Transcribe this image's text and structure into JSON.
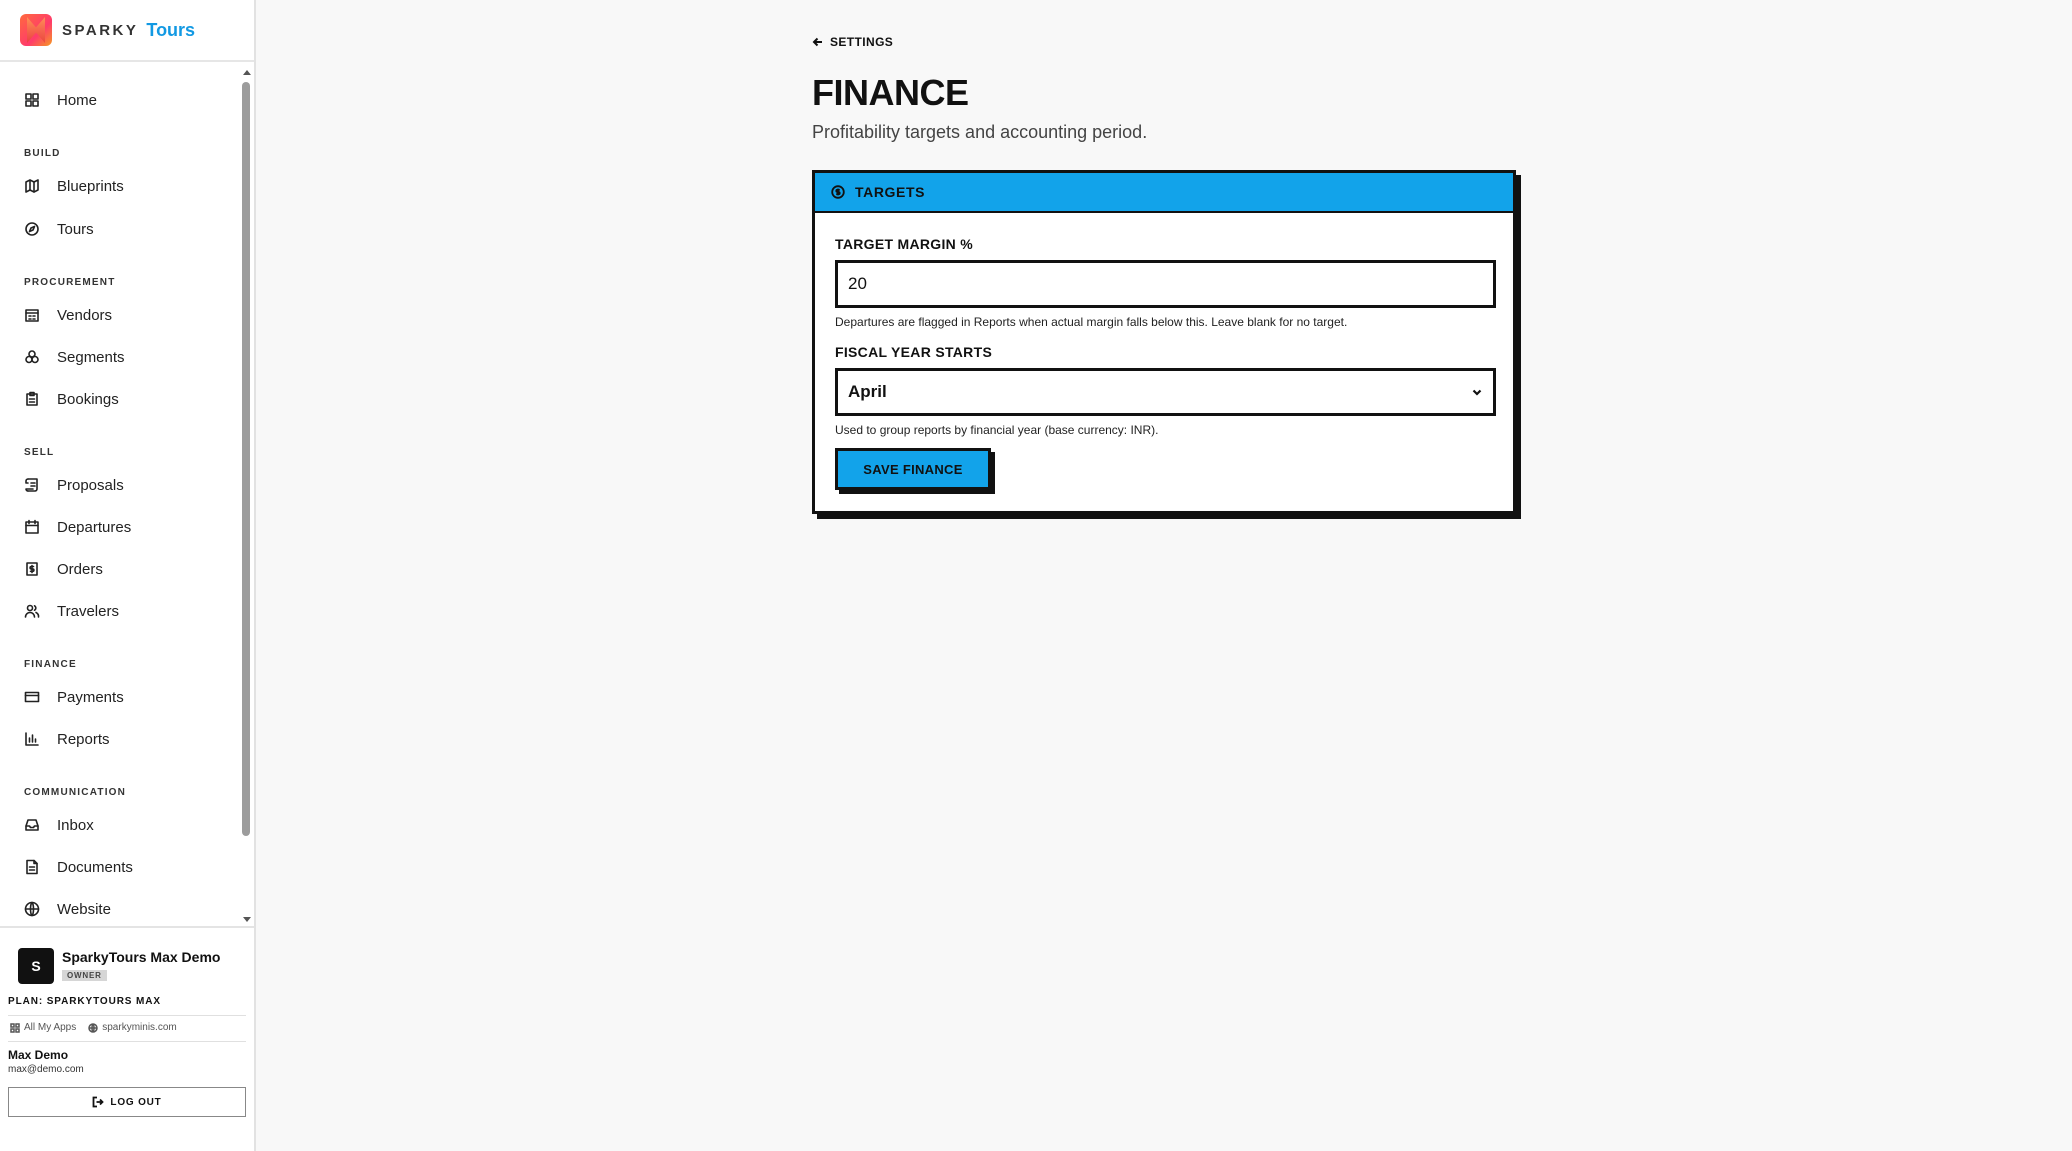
{
  "brand": {
    "word": "SPARKY",
    "product": "Tours"
  },
  "nav": {
    "home": "Home",
    "sections": {
      "build": "BUILD",
      "procurement": "PROCUREMENT",
      "sell": "SELL",
      "finance": "FINANCE",
      "communication": "COMMUNICATION"
    },
    "items": {
      "blueprints": "Blueprints",
      "tours": "Tours",
      "vendors": "Vendors",
      "segments": "Segments",
      "bookings": "Bookings",
      "proposals": "Proposals",
      "departures": "Departures",
      "orders": "Orders",
      "travelers": "Travelers",
      "payments": "Payments",
      "reports": "Reports",
      "inbox": "Inbox",
      "documents": "Documents",
      "website": "Website"
    }
  },
  "org": {
    "avatar_letter": "S",
    "name": "SparkyTours Max Demo",
    "role": "OWNER",
    "plan": "PLAN: SPARKYTOURS MAX",
    "all_apps": "All My Apps",
    "site": "sparkyminis.com"
  },
  "user": {
    "name": "Max Demo",
    "email": "max@demo.com",
    "logout": "LOG OUT"
  },
  "page": {
    "back": "SETTINGS",
    "title": "FINANCE",
    "subtitle": "Profitability targets and accounting period."
  },
  "card": {
    "title": "TARGETS",
    "margin_label": "TARGET MARGIN %",
    "margin_value": "20",
    "margin_hint": "Departures are flagged in Reports when actual margin falls below this. Leave blank for no target.",
    "fy_label": "FISCAL YEAR STARTS",
    "fy_value": "April",
    "fy_hint": "Used to group reports by financial year (base currency: INR).",
    "save": "SAVE FINANCE"
  },
  "colors": {
    "accent": "#12a3ea",
    "ink": "#111111",
    "background": "#f8f8f8"
  }
}
